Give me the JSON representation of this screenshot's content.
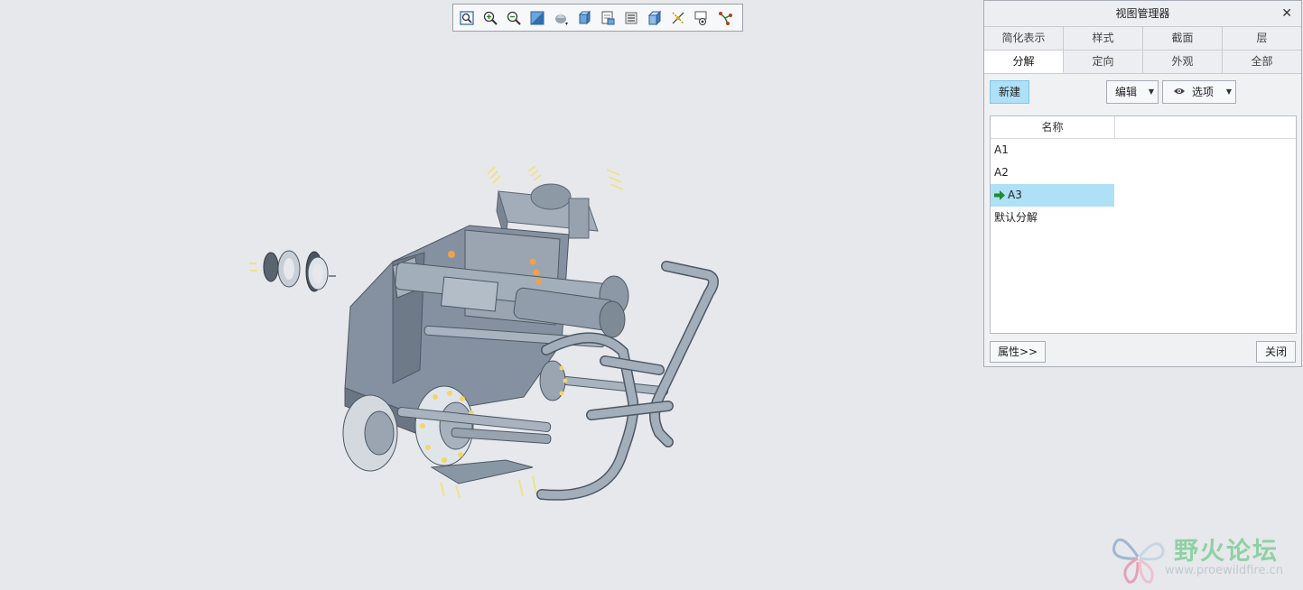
{
  "toolbar": {
    "items": [
      "refit-icon",
      "zoom-in-icon",
      "zoom-out-icon",
      "repaint-icon",
      "display-style-icon",
      "saved-orientations-icon",
      "named-views-icon",
      "layers-icon",
      "view-manager-icon",
      "datum-display-icon",
      "annotation-display-icon",
      "spin-center-icon"
    ]
  },
  "panel": {
    "title": "视图管理器",
    "tabs_row1": [
      "简化表示",
      "样式",
      "截面",
      "层"
    ],
    "tabs_row2": [
      "分解",
      "定向",
      "外观",
      "全部"
    ],
    "active_tab": "分解",
    "new_label": "新建",
    "edit_label": "编辑",
    "options_label": "选项",
    "column_name": "名称",
    "items": [
      "A1",
      "A2",
      "A3",
      "默认分解"
    ],
    "selected_item": "A3",
    "properties_label": "属性>>",
    "close_label": "关闭"
  },
  "watermark": {
    "text": "野火论坛",
    "url": "www.proewildfire.cn"
  },
  "colors": {
    "viewport_bg": "#e6e8ec",
    "selection": "#aee0f7",
    "part_fill": "#8a97a6",
    "part_dark": "#5d6773"
  }
}
